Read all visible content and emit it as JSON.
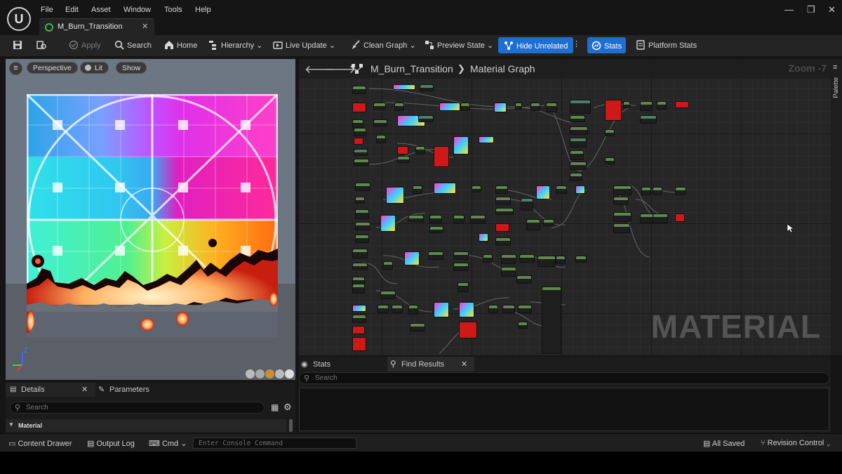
{
  "menu": {
    "items": [
      "File",
      "Edit",
      "Asset",
      "Window",
      "Tools",
      "Help"
    ]
  },
  "tab": {
    "title": "M_Burn_Transition"
  },
  "toolbar": {
    "apply": "Apply",
    "search": "Search",
    "home": "Home",
    "hierarchy": "Hierarchy",
    "live_update": "Live Update",
    "clean_graph": "Clean Graph",
    "preview_state": "Preview State",
    "hide_unrelated": "Hide Unrelated",
    "stats": "Stats",
    "platform_stats": "Platform Stats"
  },
  "viewport": {
    "perspective": "Perspective",
    "lit": "Lit",
    "show": "Show",
    "axis_z": "Z"
  },
  "graph": {
    "asset_name": "M_Burn_Transition",
    "separator": "❯",
    "graph_name": "Material Graph",
    "zoom": "Zoom -7",
    "watermark": "MATERIAL",
    "palette": "Palette"
  },
  "details": {
    "tab_details": "Details",
    "tab_parameters": "Parameters",
    "search_placeholder": "Search",
    "section": "Material"
  },
  "stats_panel": {
    "tab_stats": "Stats",
    "tab_find": "Find Results",
    "search_placeholder": "Search"
  },
  "bottombar": {
    "content_drawer": "Content Drawer",
    "output_log": "Output Log",
    "cmd": "Cmd",
    "console_placeholder": "Enter Console Command",
    "all_saved": "All Saved",
    "revision_control": "Revision Control"
  },
  "colors": {
    "accent": "#1f6fd1",
    "background": "#151515",
    "panel": "#242424",
    "graph_bg": "#262626"
  }
}
